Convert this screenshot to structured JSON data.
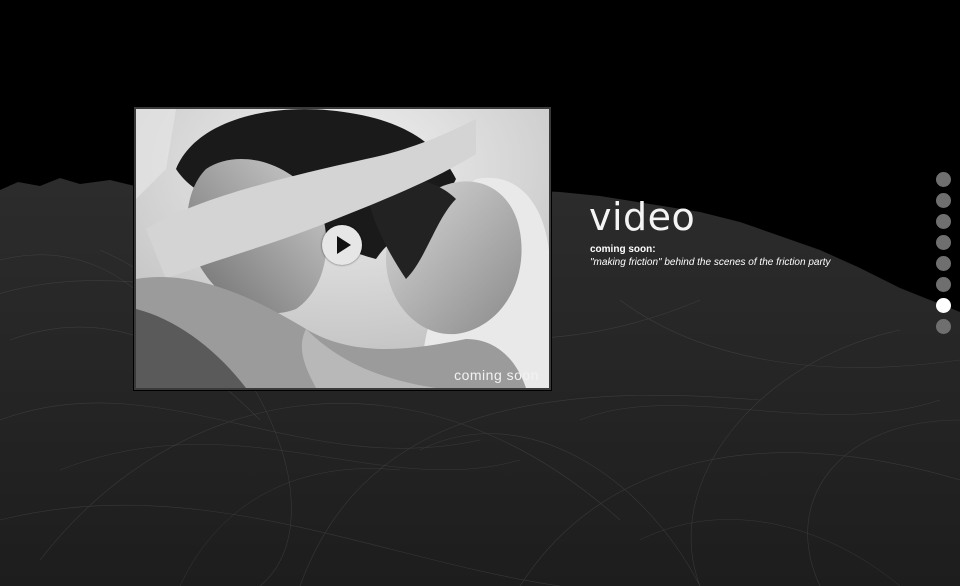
{
  "section": {
    "title": "video",
    "subhead": "coming soon:",
    "description": "\"making friction\" behind the scenes of the friction party"
  },
  "video": {
    "caption": "coming soon",
    "play_icon": "play-icon"
  },
  "navigation": {
    "dot_count": 8,
    "active_index": 6,
    "dot_icon": "circle-icon"
  },
  "colors": {
    "background": "#000000",
    "accent": "#ffffff",
    "inactive_dot": "#6f6f6f"
  }
}
